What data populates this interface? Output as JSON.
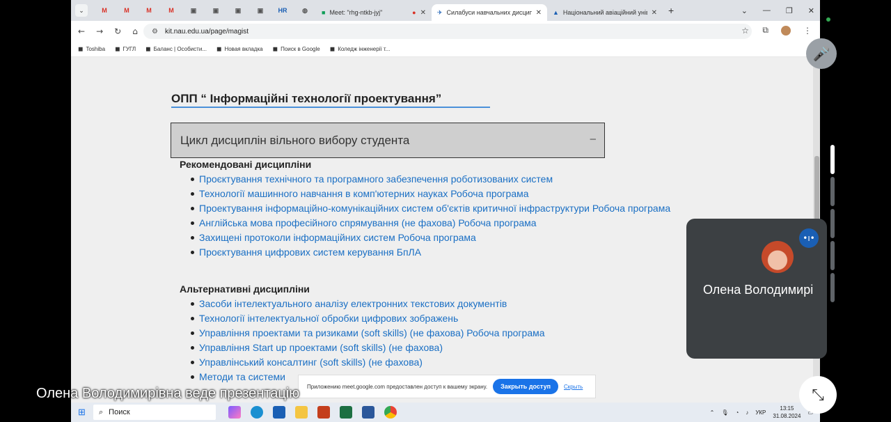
{
  "browser": {
    "pinned_tabs": [
      "M",
      "M",
      "M",
      "M",
      "▣",
      "▣",
      "▣",
      "▣",
      "HR",
      "◍"
    ],
    "tabs": [
      {
        "label": "Meet: \"rhg-ntkb-jyj\"",
        "active": false
      },
      {
        "label": "Силабуси навчальних дисципл",
        "active": true
      },
      {
        "label": "Національний авіаційний унів",
        "active": false
      }
    ],
    "url": "kit.nau.edu.ua/page/magist",
    "bookmarks": [
      "Toshiba",
      "ГУГЛ",
      "Баланс | Особисти...",
      "Новая вкладка",
      "Поиск в Google",
      "Коледж інженерії т..."
    ]
  },
  "page": {
    "title": "ОПП “ Інформаційні технології проектування”",
    "accordion_label": "Цикл дисциплін вільного вибору студента",
    "accordion_toggle": "–",
    "recommended_heading": "Рекомендовані дисципліни",
    "recommended": [
      "Проєктування технічного та програмного забезпечення роботизованих систем",
      "Технології машинного навчання в комп'ютерних науках Робоча програма",
      "Проектування інформаційно-комунікаційних систем об'єктів критичної інфраструктури Робоча програма",
      "Англійська мова професійного спрямування (не фахова) Робоча програма",
      "Захищені протоколи інформаційних систем Робоча програма",
      "Проєктування цифрових систем керування БпЛА"
    ],
    "alternative_heading": "Альтернативні дисципліни",
    "alternative": [
      "Засоби інтелектуального аналізу електронних текстових документів",
      "Технології інтелектуальної обробки цифрових зображень",
      "Управління проектами та ризиками (soft skills) (не фахова) Робоча програма",
      "Управління Start up проектами (soft skills) (не фахова)",
      "Управлінський консалтинг (soft skills) (не фахова)",
      "Методи та системи"
    ]
  },
  "share_bar": {
    "text": "Приложению meet.google.com предоставлен доступ к вашему экрану.",
    "stop_label": "Закрыть доступ",
    "hide_label": "Скрыть"
  },
  "meet": {
    "participant_name": "Олена Володимирі",
    "presenting_text": "Олена Володимирівна веде презентацію"
  },
  "taskbar": {
    "search_label": "Поиск",
    "lang": "УКР",
    "time": "13:15",
    "date": "31.08.2024"
  }
}
